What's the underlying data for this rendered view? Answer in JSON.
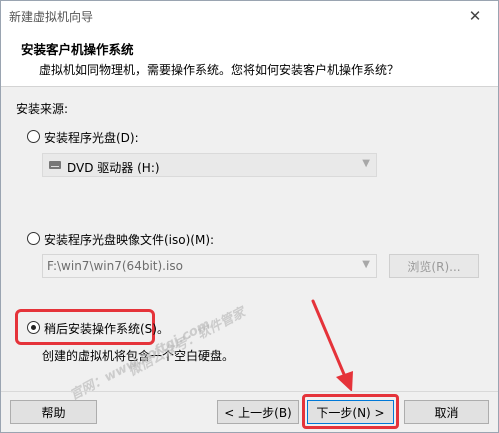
{
  "window": {
    "title": "新建虚拟机向导"
  },
  "header": {
    "title": "安装客户机操作系统",
    "subtitle": "虚拟机如同物理机，需要操作系统。您将如何安装客户机操作系统？"
  },
  "source_label": "安装来源:",
  "options": {
    "disc": {
      "label": "安装程序光盘(D):",
      "selected": false,
      "drive_value": "DVD 驱动器 (H:)"
    },
    "iso": {
      "label": "安装程序光盘映像文件(iso)(M):",
      "selected": false,
      "path_value": "F:\\win7\\win7(64bit).iso",
      "browse_label": "浏览(R)..."
    },
    "later": {
      "label": "稍后安装操作系统(S)。",
      "selected": true,
      "description": "创建的虚拟机将包含一个空白硬盘。"
    }
  },
  "buttons": {
    "help": "帮助",
    "back": "< 上一步(B)",
    "next": "下一步(N) >",
    "cancel": "取消"
  },
  "watermarks": {
    "line1": "微信公众号：软件管家",
    "line2": "官网：www.softgj.com"
  },
  "colors": {
    "highlight": "#e5333a"
  }
}
